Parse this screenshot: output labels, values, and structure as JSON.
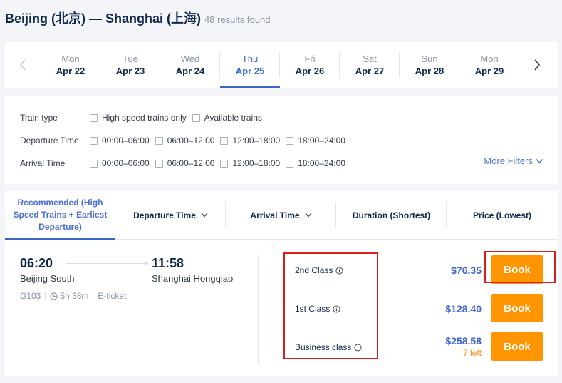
{
  "header": {
    "title": "Beijing (北京) — Shanghai (上海)",
    "results": "48 results found"
  },
  "datebar": {
    "prev_icon": "chevron-left-icon",
    "next_icon": "chevron-right-icon",
    "dates": [
      {
        "dow": "Mon",
        "date": "Apr 22",
        "active": false
      },
      {
        "dow": "Tue",
        "date": "Apr 23",
        "active": false
      },
      {
        "dow": "Wed",
        "date": "Apr 24",
        "active": false
      },
      {
        "dow": "Thu",
        "date": "Apr 25",
        "active": true
      },
      {
        "dow": "Fri",
        "date": "Apr 26",
        "active": false
      },
      {
        "dow": "Sat",
        "date": "Apr 27",
        "active": false
      },
      {
        "dow": "Sun",
        "date": "Apr 28",
        "active": false
      },
      {
        "dow": "Mon",
        "date": "Apr 29",
        "active": false
      }
    ]
  },
  "filters": {
    "train_type": {
      "label": "Train type",
      "options": [
        "High speed trains only",
        "Available trains"
      ]
    },
    "departure_time": {
      "label": "Departure Time",
      "options": [
        "00:00–06:00",
        "06:00–12:00",
        "12:00–18:00",
        "18:00–24:00"
      ]
    },
    "arrival_time": {
      "label": "Arrival Time",
      "options": [
        "00:00–06:00",
        "06:00–12:00",
        "12:00–18:00",
        "18:00–24:00"
      ]
    },
    "more_filters": "More Filters"
  },
  "sort": {
    "tabs": [
      {
        "label": "Recommended (High Speed Trains + Earliest Departure)",
        "active": true,
        "dropdown": false
      },
      {
        "label": "Departure Time",
        "active": false,
        "dropdown": true
      },
      {
        "label": "Arrival Time",
        "active": false,
        "dropdown": true
      },
      {
        "label": "Duration (Shortest)",
        "active": false,
        "dropdown": false
      },
      {
        "label": "Price (Lowest)",
        "active": false,
        "dropdown": false
      }
    ]
  },
  "result": {
    "dep_time": "06:20",
    "arr_time": "11:58",
    "dep_station": "Beijing South",
    "arr_station": "Shanghai Hongqiao",
    "train_no": "G103",
    "duration": "5h 38m",
    "ticket_type": "E-ticket",
    "seats": [
      {
        "name": "2nd Class",
        "price": "$76.35",
        "left": "",
        "book": "Book"
      },
      {
        "name": "1st Class",
        "price": "$128.40",
        "left": "",
        "book": "Book"
      },
      {
        "name": "Business class",
        "price": "$258.58",
        "left": "7 left",
        "book": "Book"
      }
    ]
  },
  "colors": {
    "accent": "#3b66c4",
    "price": "#3d63d8",
    "book": "#ff9500",
    "annotation": "#d81e1e"
  }
}
